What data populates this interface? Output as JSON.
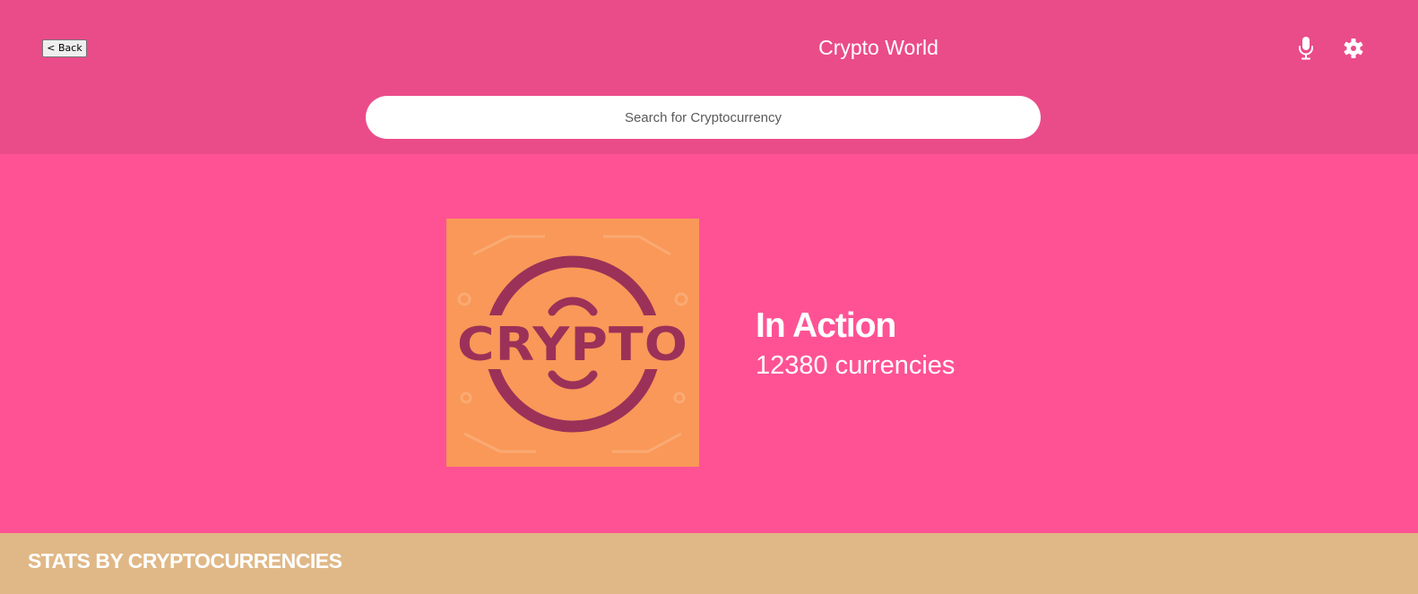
{
  "header": {
    "back_label": "< Back",
    "title": "Crypto World",
    "mic_icon": "microphone-icon",
    "settings_icon": "gear-icon"
  },
  "search": {
    "placeholder": "Search for Cryptocurrency",
    "value": ""
  },
  "hero": {
    "logo_text": "CRYPTO",
    "title": "In Action",
    "count": "12380",
    "count_unit": "currencies"
  },
  "stats": {
    "title": "STATS BY CRYPTOCURRENCIES"
  },
  "colors": {
    "header_bg": "#ea4c89",
    "hero_bg": "#ff5294",
    "logo_bg": "#f99858",
    "logo_fg": "#9b3158",
    "stats_bg": "#e0b887"
  }
}
